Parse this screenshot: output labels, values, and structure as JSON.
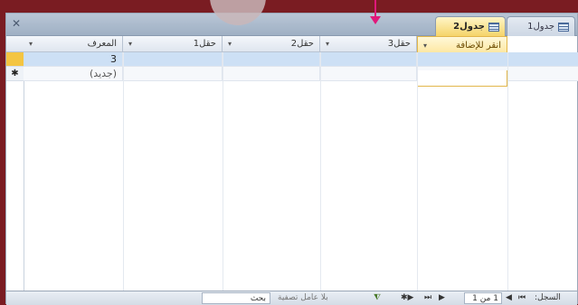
{
  "tabs": [
    {
      "label": "جدول1",
      "active": false,
      "icon": "table-icon"
    },
    {
      "label": "جدول2",
      "active": true,
      "icon": "table-icon"
    }
  ],
  "columns": [
    "المعرف",
    "حقل1",
    "حقل2",
    "حقل3"
  ],
  "add_column_label": "انقر للإضافة",
  "dropdown_glyph": "▾",
  "rows": [
    {
      "id": "3",
      "values": [
        "",
        "",
        ""
      ]
    },
    {
      "id": "(جديد)",
      "values": [
        "",
        "",
        ""
      ]
    }
  ],
  "selector_marks": {
    "current": "",
    "new": "✱"
  },
  "navigation": {
    "record_label": "السجل:",
    "position": "1 من 1",
    "filter_label": "بلا عامل تصفية",
    "search_label": "بحث",
    "buttons": [
      "⏮",
      "◀",
      "▶",
      "⏭",
      "▶✱"
    ]
  },
  "colors": {
    "active_tab": "#f5d46a",
    "selected_row": "#cde0f5",
    "annotation_arrow": "#e0187a"
  }
}
